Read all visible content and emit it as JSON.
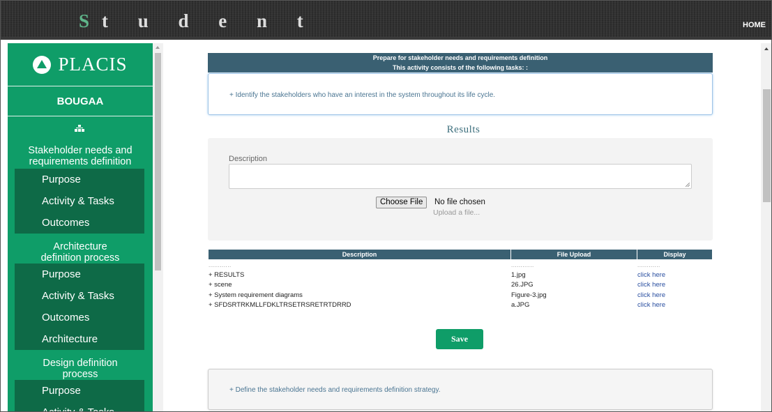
{
  "header": {
    "title_first": "S",
    "title_rest": "t u d e n t",
    "home_label": "HOME"
  },
  "sidebar": {
    "logo_text": "PLACIS",
    "user_name": "BOUGAA",
    "sections": [
      {
        "title": "Stakeholder needs and requirements definition",
        "items": [
          "Purpose",
          "Activity & Tasks",
          "Outcomes"
        ]
      },
      {
        "title_line1": "Architecture",
        "title_line2": "definition process",
        "items": [
          "Purpose",
          "Activity & Tasks",
          "Outcomes",
          "Architecture"
        ]
      },
      {
        "title_line1": "Design definition",
        "title_line2": "process",
        "items": [
          "Purpose",
          "Activity & Tasks"
        ]
      }
    ]
  },
  "main": {
    "activity_title": "Prepare for stakeholder needs and requirements definition",
    "activity_subtitle": "This activity consists of the following tasks: :",
    "task1": "+ Identify the stakeholders who have an interest in the system throughout its life cycle.",
    "results_heading": "Results",
    "description_label": "Description",
    "description_value": "",
    "choose_file_label": "Choose File",
    "no_file_label": "No file chosen",
    "upload_hint": "Upload a file...",
    "table": {
      "headers": [
        "Description",
        "File Upload",
        "Display"
      ],
      "dots": "............",
      "rows": [
        {
          "description": "+ RESULTS",
          "file": "1.jpg",
          "display": "click here"
        },
        {
          "description": "+ scene",
          "file": "26.JPG",
          "display": "click here"
        },
        {
          "description": "+ System requirement diagrams",
          "file": "Figure-3.jpg",
          "display": "click here"
        },
        {
          "description": "+ SFDSRTRKMLLFDKLTRSETRSRETRTDRRD",
          "file": "a.JPG",
          "display": "click here"
        }
      ]
    },
    "save_label": "Save",
    "task2": "+ Define the stakeholder needs and requirements definition strategy."
  },
  "colors": {
    "sidebar_green": "#0f9d68",
    "submenu_dark_green": "#0e6a47",
    "table_header": "#3a6072",
    "link": "#2a4fa0"
  }
}
